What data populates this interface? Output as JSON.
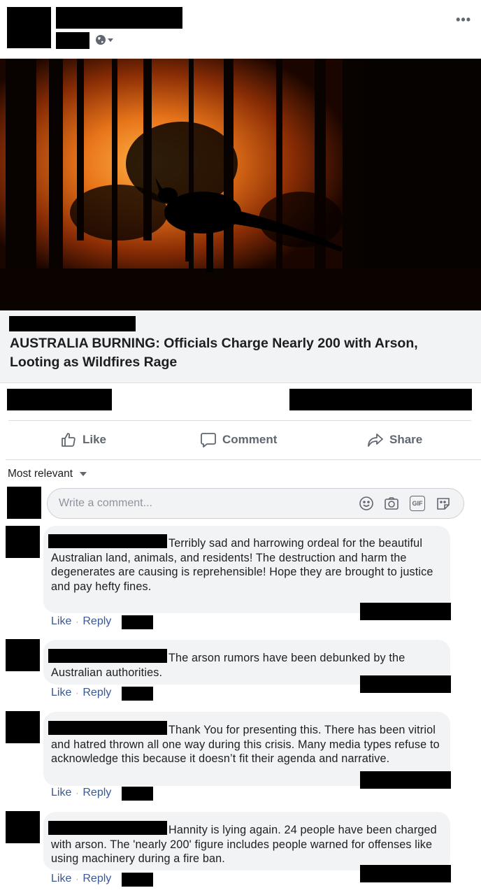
{
  "post": {
    "privacy_icon": "globe-icon",
    "more_icon": "more-options-icon",
    "more_label": "•••"
  },
  "link_preview": {
    "title": "AUSTRALIA BURNING: Officials Charge Nearly 200 with Arson, Looting as Wildfires Rage"
  },
  "actions": {
    "like": "Like",
    "comment": "Comment",
    "share": "Share"
  },
  "sort": {
    "label": "Most relevant"
  },
  "composer": {
    "placeholder": "Write a comment...",
    "tools": [
      "emoji-icon",
      "camera-icon",
      "gif-icon",
      "sticker-icon"
    ],
    "gif_label": "GIF"
  },
  "comments": [
    {
      "text": "Terribly sad and harrowing ordeal for the beautiful Australian land, animals, and residents! The destruction and harm the degenerates are causing is reprehensible! Hope they are brought to justice and pay hefty fines.",
      "like": "Like",
      "reply": "Reply"
    },
    {
      "text": "The arson rumors have been debunked by the Australian authorities.",
      "like": "Like",
      "reply": "Reply"
    },
    {
      "text": "Thank You for presenting this. There has been vitriol and hatred thrown all one way during this crisis. Many media types refuse to acknowledge this because it doesn’t fit their agenda and narrative.",
      "like": "Like",
      "reply": "Reply"
    },
    {
      "text": "Hannity is lying again. 24 people have been charged with arson. The 'nearly 200' figure includes people warned for offenses like using machinery during a fire ban.",
      "like": "Like",
      "reply": "Reply"
    }
  ],
  "colors": {
    "link_blue": "#385898",
    "gray_text": "#606770",
    "bubble_bg": "#f2f3f5",
    "fire_orange": "#e8751a"
  }
}
